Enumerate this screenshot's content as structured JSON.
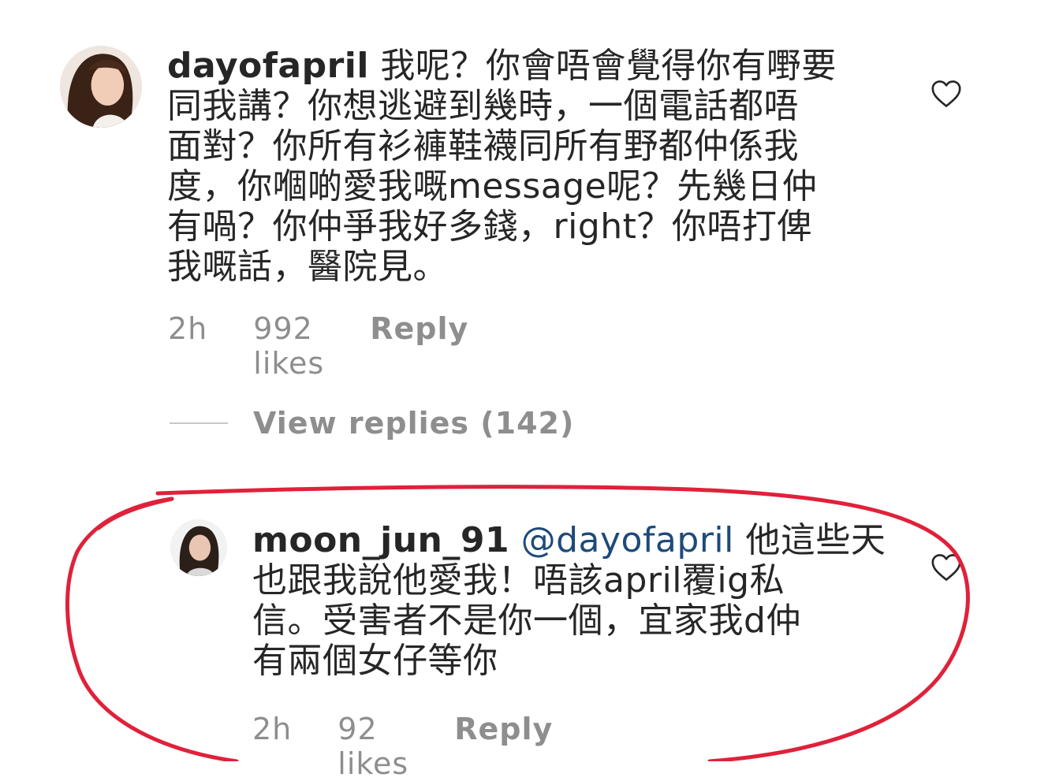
{
  "comments": [
    {
      "username": "dayofapril",
      "text_line1": " 我呢？你會唔會覺得你有嘢要",
      "text_rest": "同我講？你想逃避到幾時，一個電話都唔\n面對？你所有衫褲鞋襪同所有野都仲係我\n度，你嗰啲愛我嘅message呢？先幾日仲\n有喎？你仲爭我好多錢，right？你唔打俾\n我嘅話，醫院見。",
      "time": "2h",
      "likes": "992 likes",
      "reply_label": "Reply",
      "heart_icon": "heart-outline-icon"
    },
    {
      "username": "moon_jun_91",
      "mention": "@dayofapril",
      "text_line1": " 他這些天",
      "text_rest": "也跟我說他愛我！唔該april覆ig私\n信。受害者不是你一個，宜家我d仲\n有兩個女仔等你",
      "time": "2h",
      "likes": "92 likes",
      "reply_label": "Reply",
      "heart_icon": "heart-outline-icon"
    }
  ],
  "view_replies": "View replies (142)",
  "colors": {
    "text": "#262626",
    "meta": "#8e8e8e",
    "mention": "#1e4a7a",
    "highlight": "#e0213a"
  }
}
